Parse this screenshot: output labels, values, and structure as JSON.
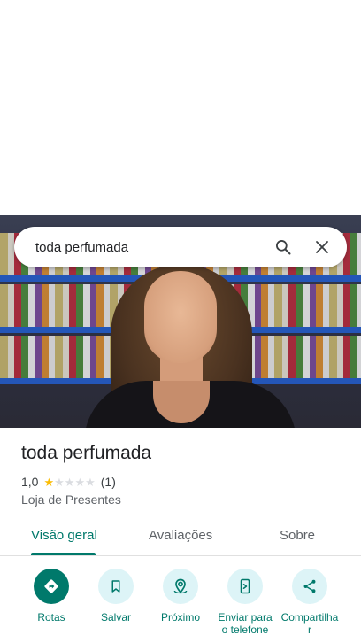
{
  "search": {
    "query": "toda perfumada"
  },
  "place": {
    "name": "toda perfumada",
    "rating_value": "1,0",
    "rating_stars": 1,
    "review_count": "(1)",
    "category": "Loja de Presentes"
  },
  "tabs": [
    {
      "label": "Visão geral",
      "active": true
    },
    {
      "label": "Avaliações",
      "active": false
    },
    {
      "label": "Sobre",
      "active": false
    }
  ],
  "actions": [
    {
      "label": "Rotas",
      "icon": "directions-icon"
    },
    {
      "label": "Salvar",
      "icon": "bookmark-icon"
    },
    {
      "label": "Próximo",
      "icon": "nearby-icon"
    },
    {
      "label": "Enviar para o telefone",
      "icon": "send-to-phone-icon"
    },
    {
      "label": "Compartilhar",
      "icon": "share-icon"
    }
  ],
  "colors": {
    "accent": "#00796b",
    "action_bg": "#ddf4f7",
    "star": "#fbbc04"
  }
}
